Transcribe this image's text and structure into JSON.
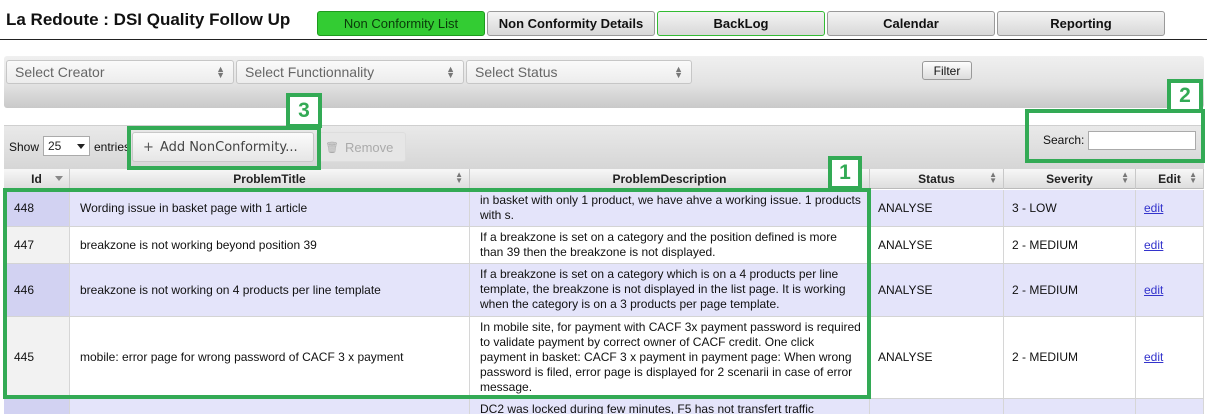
{
  "header": {
    "title": "La Redoute : DSI Quality Follow Up",
    "tabs": [
      {
        "label": "Non Conformity List",
        "active": true
      },
      {
        "label": "Non Conformity Details",
        "active": false
      },
      {
        "label": "BackLog",
        "active": false
      },
      {
        "label": "Calendar",
        "active": false
      },
      {
        "label": "Reporting",
        "active": false
      }
    ]
  },
  "filters": {
    "creator_placeholder": "Select Creator",
    "functionality_placeholder": "Select Functionnality",
    "status_placeholder": "Select Status",
    "filter_button": "Filter"
  },
  "toolbar": {
    "show_label": "Show",
    "page_size": "25",
    "entries_label": "entries",
    "add_button": "Add NonConformity...",
    "remove_button": "Remove",
    "search_label": "Search:",
    "search_value": ""
  },
  "table": {
    "columns": [
      "Id",
      "ProblemTitle",
      "ProblemDescription",
      "Status",
      "Severity",
      "Edit"
    ],
    "rows": [
      {
        "id": "448",
        "title": "Wording issue in basket page with 1 article",
        "description": "in basket with only 1 product, we have ahve a working issue. 1 products with s.",
        "status": "ANALYSE",
        "severity": "3 - LOW",
        "edit": "edit"
      },
      {
        "id": "447",
        "title": "breakzone is not working beyond position 39",
        "description": "If a breakzone is set on a category and the position defined is more than 39 then the breakzone is not displayed.",
        "status": "ANALYSE",
        "severity": "2 - MEDIUM",
        "edit": "edit"
      },
      {
        "id": "446",
        "title": "breakzone is not working on 4 products per line template",
        "description": "If a breakzone is set on a category which is on a 4 products per line template, the breakzone is not displayed in the list page. It is working when the category is on a 3 products per page template.",
        "status": "ANALYSE",
        "severity": "2 - MEDIUM",
        "edit": "edit"
      },
      {
        "id": "445",
        "title": "mobile: error page for wrong password of CACF 3 x payment",
        "description": "In mobile site, for payment with CACF 3x payment password is required to validate payment by correct owner of CACF credit. One click payment in basket: CACF 3 x payment in payment page: When wrong password is filed, error page is displayed for 2 scenarii in case of error message.",
        "status": "ANALYSE",
        "severity": "2 - MEDIUM",
        "edit": "edit"
      },
      {
        "id": "",
        "title": "",
        "description": "DC2 was locked during few minutes, F5 has not transfert traffic",
        "status": "",
        "severity": "",
        "edit": ""
      }
    ]
  },
  "annotations": {
    "labels": [
      "1",
      "2",
      "3"
    ],
    "color": "#33aa55"
  },
  "colors": {
    "active_tab": "#33cc33",
    "odd_row": "#e4e4fa",
    "link": "#3333cc"
  }
}
